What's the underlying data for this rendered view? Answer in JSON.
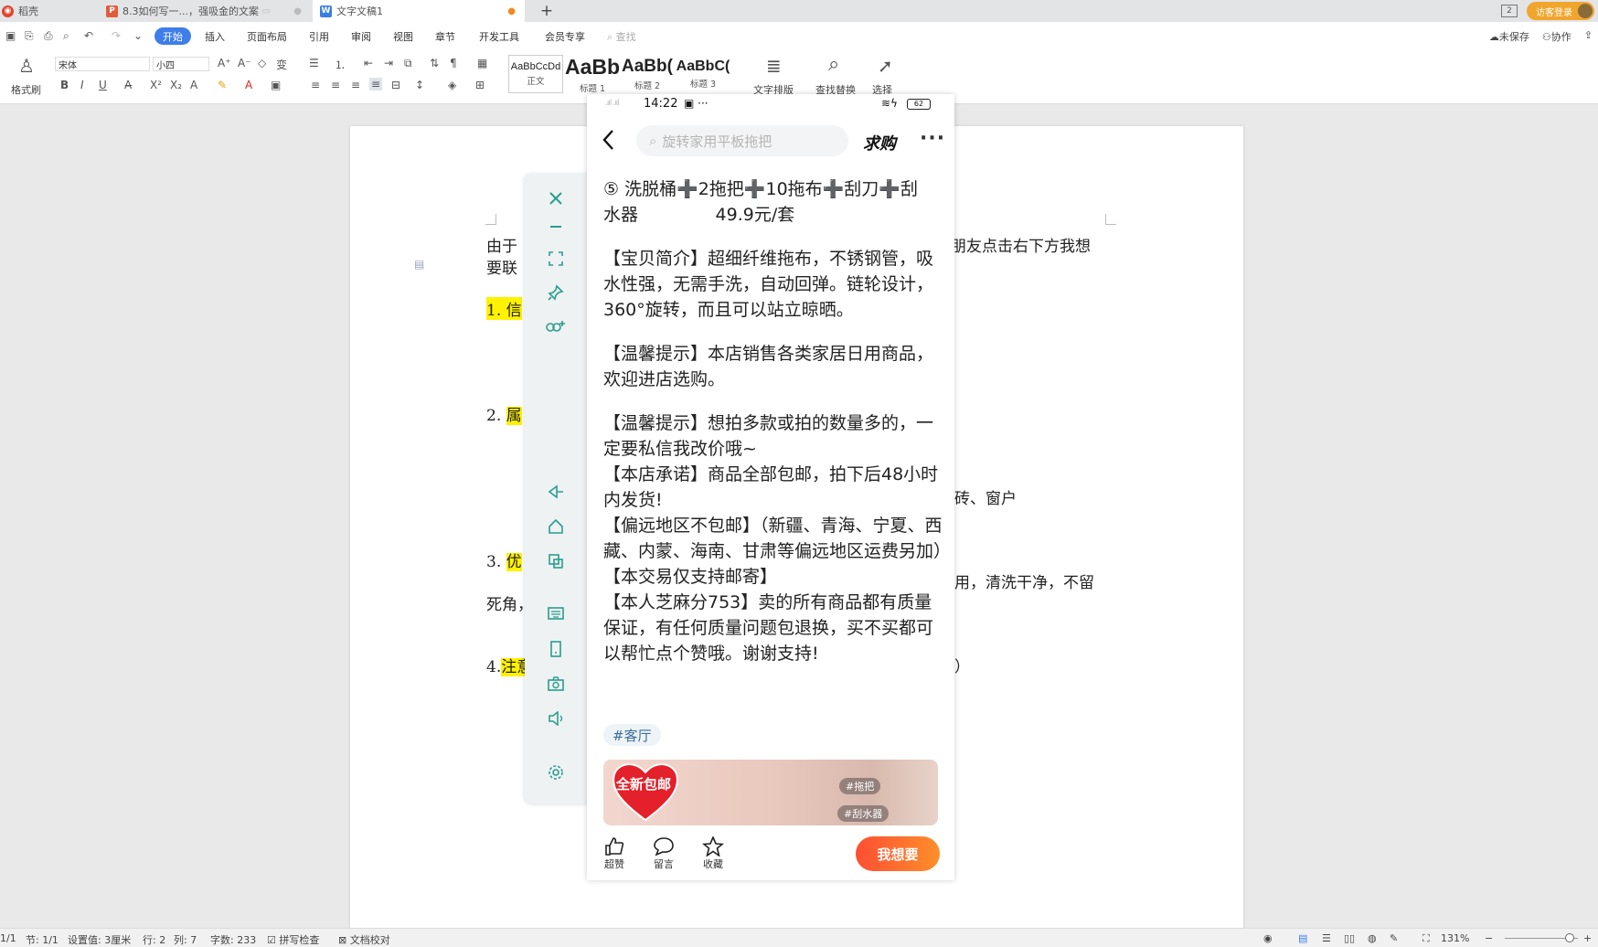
{
  "tabs": [
    {
      "label": "稻壳",
      "icon": "docer-icon",
      "color": "#e0452b"
    },
    {
      "label": "8.3如何写一...，强吸金的文案",
      "icon": "ppt-icon",
      "color": "#e25c3c"
    },
    {
      "label": "文字文稿1",
      "icon": "writer-icon",
      "color": "#3b7fe3",
      "active": true
    }
  ],
  "window": {
    "count_badge": "2",
    "guest_login": "访客登录"
  },
  "menu": {
    "start": "开始",
    "items": [
      "插入",
      "页面布局",
      "引用",
      "审阅",
      "视图",
      "章节",
      "开发工具",
      "会员专享"
    ],
    "search_placeholder": "查找",
    "right": {
      "unsaved": "未保存",
      "collab": "协作"
    }
  },
  "toolbar": {
    "format_painter": "格式刷",
    "font_name": "宋体",
    "font_size": "小四",
    "styles": [
      {
        "sample": "AaBbCcDd",
        "label": "正文"
      },
      {
        "sample": "AaBb",
        "label": "标题 1"
      },
      {
        "sample": "AaBb(",
        "label": "标题 2"
      },
      {
        "sample": "AaBbC(",
        "label": "标题 3"
      }
    ],
    "text_layout": "文字排版",
    "find_replace": "查找替换",
    "select": "选择"
  },
  "document": {
    "line1_left": "由于",
    "line1_right": "朋友点击右下方我想",
    "line2": "要联",
    "item1": "1. 信",
    "item2": "2. 属",
    "item2_right": "砖、窗户",
    "item3": "3. 优",
    "item3_right": "用，清洗干净，不留",
    "item3_line2": "死角，",
    "item4_num": "4.",
    "item4": "注意",
    "item4_right": "）"
  },
  "phone": {
    "time": "14:22",
    "battery": "62",
    "search_placeholder": "旋转家用平板拖把",
    "buy_label": "求购",
    "post": {
      "line_title_1": "⑤ 洗脱桶➕2拖把➕10拖布➕刮刀➕刮",
      "line_title_2": "水器              49.9元/套",
      "para_intro": "【宝贝简介】超细纤维拖布，不锈钢管，吸水性强，无需手洗，自动回弹。链轮设计，360°旋转，而且可以站立晾晒。",
      "para_tip1": "【温馨提示】本店销售各类家居日用商品，欢迎进店选购。",
      "para_tip2": "【温馨提示】想拍多款或拍的数量多的，一定要私信我改价哦~",
      "para_promise": "【本店承诺】商品全部包邮，拍下后48小时内发货!",
      "para_remote": "【偏远地区不包邮】（新疆、青海、宁夏、西藏、内蒙、海南、甘肃等偏远地区运费另加）",
      "para_trade": "【本交易仅支持邮寄】",
      "para_credit": "【本人芝麻分753】卖的所有商品都有质量保证，有任何质量问题包退换，买不买都可以帮忙点个赞哦。谢谢支持!"
    },
    "tag": "#客厅",
    "thumb": {
      "badge": "全新包邮",
      "tag1": "#拖把",
      "tag2": "#刮水器"
    },
    "actions": {
      "like": "超赞",
      "comment": "留言",
      "favorite": "收藏",
      "want": "我想要"
    }
  },
  "statusbar": {
    "page": "1/1",
    "section": "节: 1/1",
    "setting": "设置值: 3厘米",
    "row": "行: 2",
    "col": "列: 7",
    "words": "字数: 233",
    "spell": "拼写检查",
    "proof": "文档校对",
    "zoom": "131%"
  },
  "colors": {
    "accent": "#3f7ee8",
    "highlight": "#fff200",
    "want_start": "#ff4e33",
    "want_end": "#ff8f2a",
    "side_icon": "#2a9d8f"
  }
}
